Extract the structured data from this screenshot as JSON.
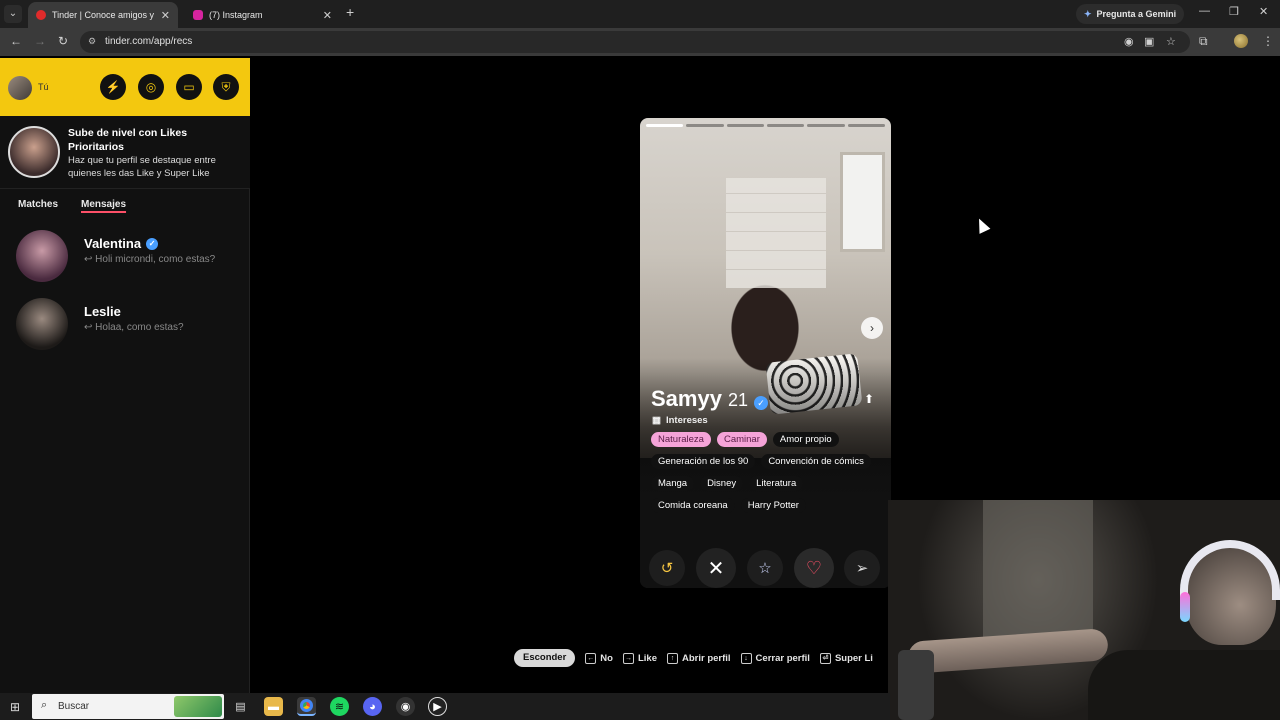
{
  "browser": {
    "tabs": [
      {
        "title": "Tinder | Conoce amigos y gente",
        "active": true,
        "favicon_color": "#e02b2b"
      },
      {
        "title": "(7) Instagram",
        "active": false,
        "favicon_color": "#d6249f"
      }
    ],
    "gemini_label": "Pregunta a Gemini",
    "url": "tinder.com/app/recs"
  },
  "sidebar": {
    "me_label": "Tú",
    "promo": {
      "title": "Sube de nivel con Likes Prioritarios",
      "description": "Haz que tu perfil se destaque entre quienes les das Like y Super Like"
    },
    "tabs": [
      {
        "label": "Matches",
        "active": false
      },
      {
        "label": "Mensajes",
        "active": true
      }
    ],
    "conversations": [
      {
        "name": "Valentina",
        "verified": true,
        "message": "Holi microndi, como estas?"
      },
      {
        "name": "Leslie",
        "verified": false,
        "message": "Holaa, como estas?"
      }
    ]
  },
  "profile": {
    "name": "Samyy",
    "age": "21",
    "verified": true,
    "section_label": "Intereses",
    "interests": [
      {
        "label": "Naturaleza",
        "shared": true
      },
      {
        "label": "Caminar",
        "shared": true
      },
      {
        "label": "Amor propio",
        "shared": false
      },
      {
        "label": "Generación de los 90",
        "shared": false
      },
      {
        "label": "Convención de cómics",
        "shared": false
      },
      {
        "label": "Manga",
        "shared": false
      },
      {
        "label": "Disney",
        "shared": false
      },
      {
        "label": "Literatura",
        "shared": false
      },
      {
        "label": "Comida coreana",
        "shared": false
      },
      {
        "label": "Harry Potter",
        "shared": false
      }
    ],
    "photo_count": 6,
    "current_photo": 1
  },
  "shortcuts": {
    "hide_label": "Esconder",
    "items": [
      {
        "key": "←",
        "label": "No"
      },
      {
        "key": "→",
        "label": "Like"
      },
      {
        "key": "↑",
        "label": "Abrir perfil"
      },
      {
        "key": "↓",
        "label": "Cerrar perfil"
      },
      {
        "key": "⏎",
        "label": "Super Li"
      }
    ]
  },
  "taskbar": {
    "search_placeholder": "Buscar"
  },
  "colors": {
    "tinder_accent": "#fd5068",
    "gold_header": "#f3c80f",
    "interest_highlight": "#f5a3d8"
  }
}
